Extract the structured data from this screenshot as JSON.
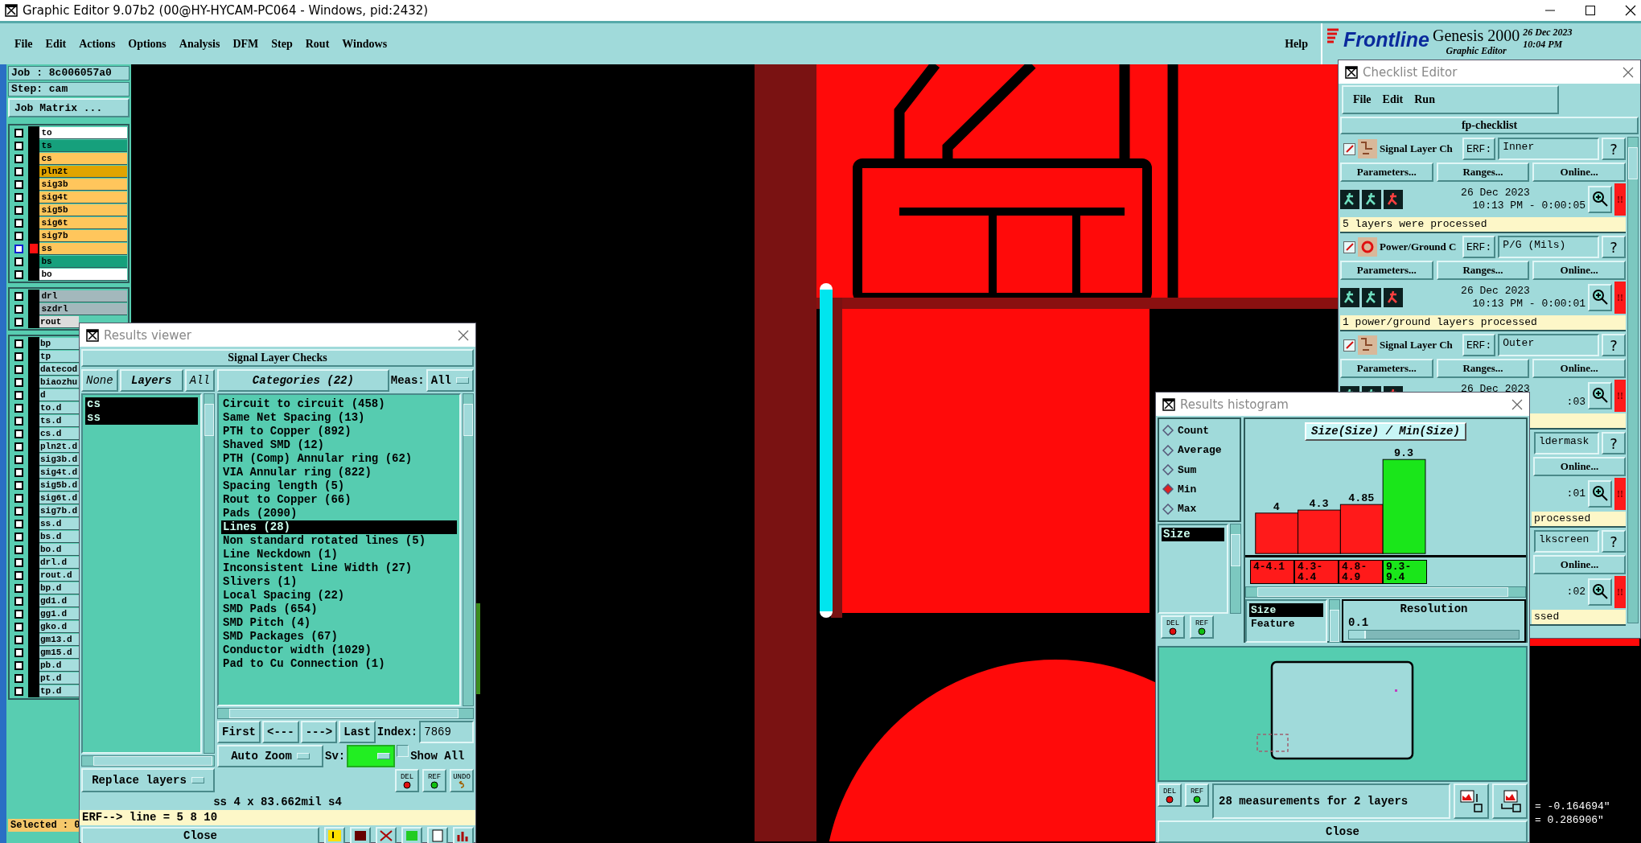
{
  "window": {
    "title": "Graphic Editor 9.07b2 (00@HY-HYCAM-PC064 - Windows, pid:2432)"
  },
  "menu": {
    "items": [
      "File",
      "Edit",
      "Actions",
      "Options",
      "Analysis",
      "DFM",
      "Step",
      "Rout",
      "Windows"
    ],
    "help": "Help"
  },
  "brand": {
    "logo": "Frontline",
    "product": "Genesis 2000",
    "subtitle": "Graphic Editor",
    "date": "26 Dec 2023",
    "time": "10:04 PM"
  },
  "job_panel": {
    "job": "Job : 8c006057a0",
    "step": "Step: cam",
    "matrix_button": "Job Matrix ...",
    "layer_groups": [
      [
        {
          "name": "to",
          "color": "#ffffff",
          "checked": false,
          "active": false
        },
        {
          "name": "ts",
          "color": "#16a07c",
          "checked": false,
          "active": false
        },
        {
          "name": "cs",
          "color": "#ffc65c",
          "checked": false,
          "active": false
        },
        {
          "name": "pln2t",
          "color": "#e0a400",
          "checked": false,
          "active": false
        },
        {
          "name": "sig3b",
          "color": "#ffc65c",
          "checked": false,
          "active": false
        },
        {
          "name": "sig4t",
          "color": "#ffc65c",
          "checked": false,
          "active": false
        },
        {
          "name": "sig5b",
          "color": "#ffc65c",
          "checked": false,
          "active": false
        },
        {
          "name": "sig6t",
          "color": "#ffc65c",
          "checked": false,
          "active": false
        },
        {
          "name": "sig7b",
          "color": "#ffc65c",
          "checked": false,
          "active": false
        },
        {
          "name": "ss",
          "color": "#ffc65c",
          "checked": false,
          "active": true
        },
        {
          "name": "bs",
          "color": "#16a07c",
          "checked": false,
          "active": false
        },
        {
          "name": "bo",
          "color": "#ffffff",
          "checked": false,
          "active": false
        }
      ],
      [
        {
          "name": "drl",
          "color": "#a3b8bc",
          "checked": false,
          "active": false
        },
        {
          "name": "szdrl",
          "color": "#a3b8bc",
          "checked": false,
          "active": false
        },
        {
          "name": "rout",
          "color": "#dcdcdc",
          "checked": false,
          "active": false
        }
      ],
      [
        {
          "name": "bp",
          "color": "#a6dede",
          "checked": false,
          "active": false
        },
        {
          "name": "tp",
          "color": "#a6dede",
          "checked": false,
          "active": false
        },
        {
          "name": "datecod",
          "color": "#a6dede",
          "checked": false,
          "active": false
        },
        {
          "name": "biaozhu",
          "color": "#a6dede",
          "checked": false,
          "active": false
        },
        {
          "name": "d",
          "color": "#a6dede",
          "checked": false,
          "active": false
        },
        {
          "name": "to.d",
          "color": "#a6dede",
          "checked": false,
          "active": false
        },
        {
          "name": "ts.d",
          "color": "#a6dede",
          "checked": false,
          "active": false
        },
        {
          "name": "cs.d",
          "color": "#a6dede",
          "checked": false,
          "active": false
        },
        {
          "name": "pln2t.d",
          "color": "#a6dede",
          "checked": false,
          "active": false
        },
        {
          "name": "sig3b.d",
          "color": "#a6dede",
          "checked": false,
          "active": false
        },
        {
          "name": "sig4t.d",
          "color": "#a6dede",
          "checked": false,
          "active": false
        },
        {
          "name": "sig5b.d",
          "color": "#a6dede",
          "checked": false,
          "active": false
        },
        {
          "name": "sig6t.d",
          "color": "#a6dede",
          "checked": false,
          "active": false
        },
        {
          "name": "sig7b.d",
          "color": "#a6dede",
          "checked": false,
          "active": false
        },
        {
          "name": "ss.d",
          "color": "#a6dede",
          "checked": false,
          "active": false
        },
        {
          "name": "bs.d",
          "color": "#a6dede",
          "checked": false,
          "active": false
        },
        {
          "name": "bo.d",
          "color": "#a6dede",
          "checked": false,
          "active": false
        },
        {
          "name": "drl.d",
          "color": "#a6dede",
          "checked": false,
          "active": false
        },
        {
          "name": "rout.d",
          "color": "#a6dede",
          "checked": false,
          "active": false
        },
        {
          "name": "bp.d",
          "color": "#a6dede",
          "checked": false,
          "active": false
        },
        {
          "name": "gd1.d",
          "color": "#a6dede",
          "checked": false,
          "active": false
        },
        {
          "name": "gg1.d",
          "color": "#a6dede",
          "checked": false,
          "active": false
        },
        {
          "name": "gko.d",
          "color": "#a6dede",
          "checked": false,
          "active": false
        },
        {
          "name": "gm13.d",
          "color": "#a6dede",
          "checked": false,
          "active": false
        },
        {
          "name": "gm15.d",
          "color": "#a6dede",
          "checked": false,
          "active": false
        },
        {
          "name": "pb.d",
          "color": "#a6dede",
          "checked": false,
          "active": false
        },
        {
          "name": "pt.d",
          "color": "#a6dede",
          "checked": false,
          "active": false
        },
        {
          "name": "tp.d",
          "color": "#a6dede",
          "checked": false,
          "active": false
        }
      ]
    ],
    "selected": "Selected : 0"
  },
  "results_viewer": {
    "title": "Results viewer",
    "check": "Signal Layer Checks",
    "layer_buttons": [
      {
        "label": "None",
        "kind": "button"
      },
      {
        "label": "Layers",
        "kind": "header"
      },
      {
        "label": "All",
        "kind": "button"
      }
    ],
    "layers": [
      {
        "name": "cs",
        "selected": true
      },
      {
        "name": "ss",
        "selected": true
      }
    ],
    "replace": "Replace layers",
    "categories_button": "Categories (22)",
    "meas_label": "Meas:",
    "meas_value": "All",
    "categories": [
      {
        "label": "Circuit to circuit (458)",
        "selected": false
      },
      {
        "label": "Same Net Spacing (13)",
        "selected": false
      },
      {
        "label": "PTH to Copper (892)",
        "selected": false
      },
      {
        "label": "Shaved SMD (12)",
        "selected": false
      },
      {
        "label": "PTH (Comp) Annular ring (62)",
        "selected": false
      },
      {
        "label": "VIA Annular ring (822)",
        "selected": false
      },
      {
        "label": "Spacing length (5)",
        "selected": false
      },
      {
        "label": "Rout to Copper (66)",
        "selected": false
      },
      {
        "label": "Pads (2090)",
        "selected": false
      },
      {
        "label": "Lines (28)",
        "selected": true
      },
      {
        "label": "Non standard rotated lines (5)",
        "selected": false
      },
      {
        "label": "Line Neckdown (1)",
        "selected": false
      },
      {
        "label": "Inconsistent Line Width (27)",
        "selected": false
      },
      {
        "label": "Slivers (1)",
        "selected": false
      },
      {
        "label": "Local Spacing (22)",
        "selected": false
      },
      {
        "label": "SMD Pads (654)",
        "selected": false
      },
      {
        "label": "SMD Pitch (4)",
        "selected": false
      },
      {
        "label": "SMD Packages (67)",
        "selected": false
      },
      {
        "label": "Conductor width (1029)",
        "selected": false
      },
      {
        "label": "Pad to Cu Connection (1)",
        "selected": false
      }
    ],
    "nav": [
      "First",
      "<---",
      "--->",
      "Last"
    ],
    "index_label": "Index:",
    "index_value": "7869",
    "zoom_mode": "Auto Zoom",
    "sv_label": "Sv:",
    "show_all": {
      "label": "Show All",
      "checked": false
    },
    "tools": [
      {
        "label": "DEL",
        "kind": "delete"
      },
      {
        "label": "REF",
        "kind": "ref"
      },
      {
        "label": "UNDO",
        "kind": "undo"
      }
    ],
    "status": "ss 4 x 83.662mil  s4",
    "erf": "ERF--> line = 5 8 10",
    "close": "Close"
  },
  "checklist_editor": {
    "title": "Checklist Editor",
    "menu": [
      "File",
      "Edit",
      "Run"
    ],
    "name": "fp-checklist",
    "checks": [
      {
        "kind": "signal",
        "checked": true,
        "name": "Signal Layer Ch",
        "erf_label": "ERF:",
        "erf": "Inner",
        "help": "?",
        "buttons": [
          "Parameters...",
          "Ranges...",
          "Online..."
        ],
        "date": "26 Dec 2023",
        "time": "10:13 PM - 0:00:05",
        "alert": "!!",
        "message": "5 layers were processed"
      },
      {
        "kind": "power",
        "checked": true,
        "name": "Power/Ground C",
        "erf_label": "ERF:",
        "erf": "P/G (Mils)",
        "help": "?",
        "buttons": [
          "Parameters...",
          "Ranges...",
          "Online..."
        ],
        "date": "26 Dec 2023",
        "time": "10:13 PM - 0:00:01",
        "alert": "!!",
        "message": "1 power/ground layers processed"
      },
      {
        "kind": "signal",
        "checked": true,
        "name": "Signal Layer Ch",
        "erf_label": "ERF:",
        "erf": "Outer",
        "help": "?",
        "buttons": [
          "Parameters...",
          "Ranges...",
          "Online..."
        ],
        "date": "26 Dec 2023",
        "time": ":03",
        "alert": "!!"
      },
      {
        "kind": "partial",
        "erf": "ldermask",
        "help": "?",
        "buttons": [
          "Online..."
        ],
        "time": ":01",
        "alert": "!!",
        "message": "processed"
      },
      {
        "kind": "partial",
        "erf": "lkscreen",
        "help": "?",
        "buttons": [
          "Online..."
        ],
        "time": ":02",
        "alert": "!!",
        "message": "ssed"
      }
    ]
  },
  "histogram": {
    "title": "Results histogram",
    "modes": [
      {
        "label": "Count",
        "selected": false
      },
      {
        "label": "Average",
        "selected": false
      },
      {
        "label": "Sum",
        "selected": false
      },
      {
        "label": "Min",
        "selected": true
      },
      {
        "label": "Max",
        "selected": false
      }
    ],
    "fields": [
      {
        "label": "Size",
        "selected": true
      }
    ],
    "chart_data": {
      "type": "bar",
      "title": "Size(Size) / Min(Size)",
      "categories": [
        "4-4.1",
        "4.3-4.4",
        "4.8-4.9",
        "9.3-9.4"
      ],
      "values": [
        4,
        4.3,
        4.85,
        9.3
      ],
      "data_labels": true
    },
    "axis_list": [
      {
        "label": "Size",
        "selected": true
      },
      {
        "label": "Feature",
        "selected": false
      }
    ],
    "resolution": {
      "label": "Resolution",
      "value": "0.1",
      "level": 0.1
    },
    "tools": [
      {
        "label": "DEL",
        "kind": "delete"
      },
      {
        "label": "REF",
        "kind": "ref"
      }
    ],
    "row_tools": [
      {
        "label": "DEL",
        "kind": "delete"
      },
      {
        "label": "REF",
        "kind": "ref"
      }
    ],
    "summary": "28 measurements for 2 layers",
    "close": "Close"
  },
  "coordinates": [
    "= -0.164694\"",
    "= 0.286906\""
  ]
}
